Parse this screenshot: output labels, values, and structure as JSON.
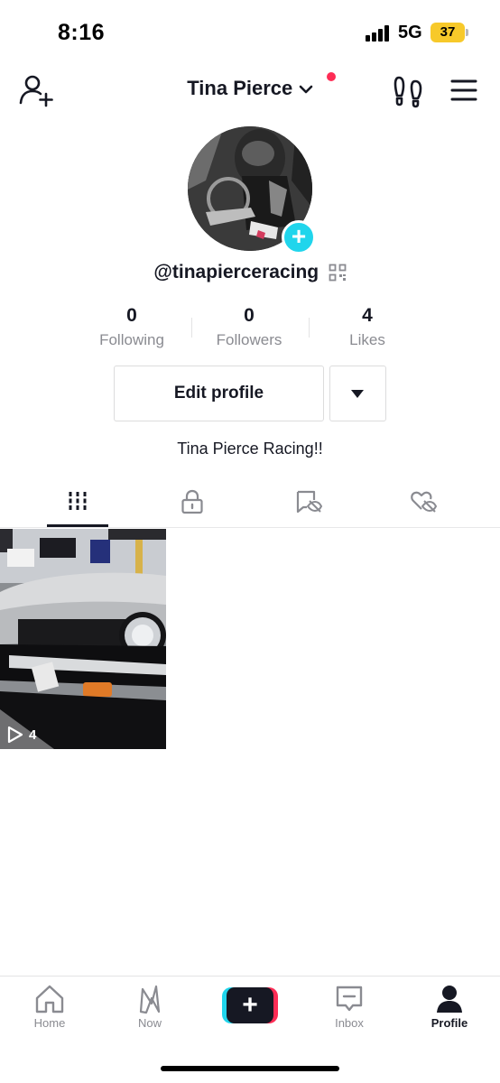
{
  "status_bar": {
    "time": "8:16",
    "network": "5G",
    "battery": "37",
    "battery_color": "#f7c92a"
  },
  "header": {
    "name": "Tina Pierce",
    "icons": {
      "left": "add-friend-icon",
      "right": [
        "footprints-icon",
        "menu-icon"
      ]
    },
    "notification_dot_color": "#fe2c55"
  },
  "profile": {
    "handle": "@tinapierceracing",
    "stats": [
      {
        "count": "0",
        "label": "Following"
      },
      {
        "count": "0",
        "label": "Followers"
      },
      {
        "count": "4",
        "label": "Likes"
      }
    ],
    "edit_profile_label": "Edit profile",
    "bio": "Tina Pierce Racing!!"
  },
  "tabs": [
    {
      "icon": "videos-grid-icon",
      "active": true
    },
    {
      "icon": "lock-icon",
      "active": false
    },
    {
      "icon": "reposts-hidden-icon",
      "active": false
    },
    {
      "icon": "liked-hidden-icon",
      "active": false
    }
  ],
  "videos": [
    {
      "views": "4"
    }
  ],
  "bottom_nav": {
    "items": [
      {
        "label": "Home",
        "icon": "home-icon",
        "active": false
      },
      {
        "label": "Now",
        "icon": "now-icon",
        "active": false
      },
      {
        "label": "",
        "icon": "plus-icon",
        "active": false
      },
      {
        "label": "Inbox",
        "icon": "inbox-icon",
        "active": false
      },
      {
        "label": "Profile",
        "icon": "profile-icon",
        "active": true
      }
    ]
  },
  "colors": {
    "accent_cyan": "#20d5ec",
    "accent_pink": "#fe2c55",
    "text_primary": "#161823",
    "text_secondary": "#8a8b91"
  }
}
